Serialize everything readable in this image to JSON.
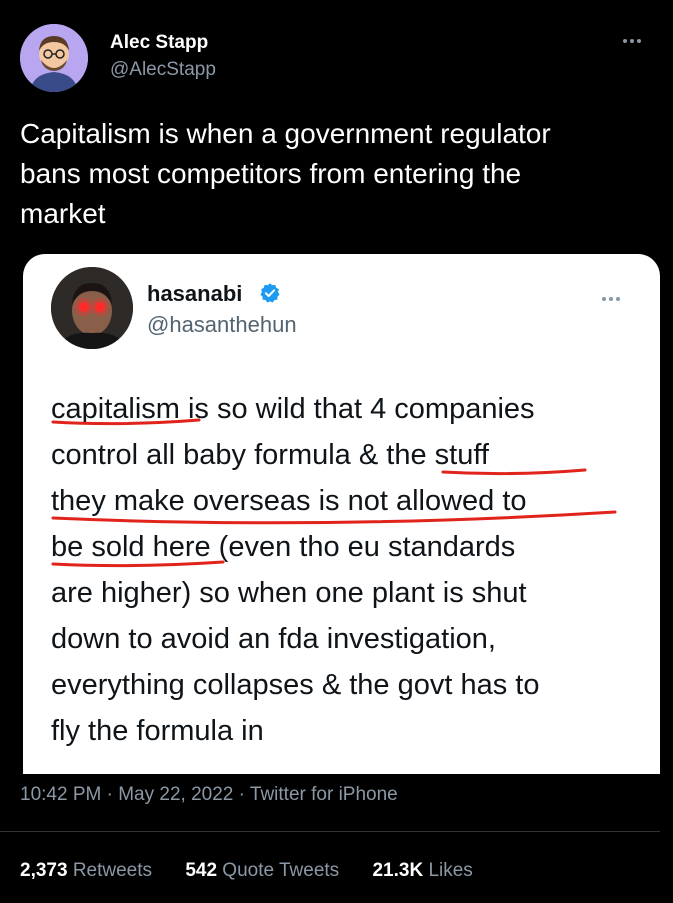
{
  "tweet": {
    "author_name": "Alec Stapp",
    "author_handle": "@AlecStapp",
    "text_lines": [
      "Capitalism is when a government regulator",
      "bans most competitors from entering the",
      "market"
    ],
    "timestamp": "10:42 PM · May 22, 2022 · Twitter for iPhone",
    "stats": {
      "retweets_count": "2,373",
      "retweets_label": "Retweets",
      "quotes_count": "542",
      "quotes_label": "Quote Tweets",
      "likes_count": "21.3K",
      "likes_label": "Likes"
    }
  },
  "quoted": {
    "author_name": "hasanabi",
    "author_handle": "@hasanthehun",
    "verified": true,
    "lines": [
      "capitalism is so wild that 4 companies",
      "control all baby formula & the stuff",
      "they make overseas is not allowed to",
      "be sold here (even tho eu standards",
      "are higher) so when one plant is shut",
      "down to avoid an fda investigation,",
      "everything collapses & the govt has to",
      "fly the formula in"
    ]
  },
  "colors": {
    "background": "#000000",
    "secondary_text": "#8b98a5",
    "verified_blue": "#1d9bf0",
    "underline_red": "#e0241b"
  }
}
